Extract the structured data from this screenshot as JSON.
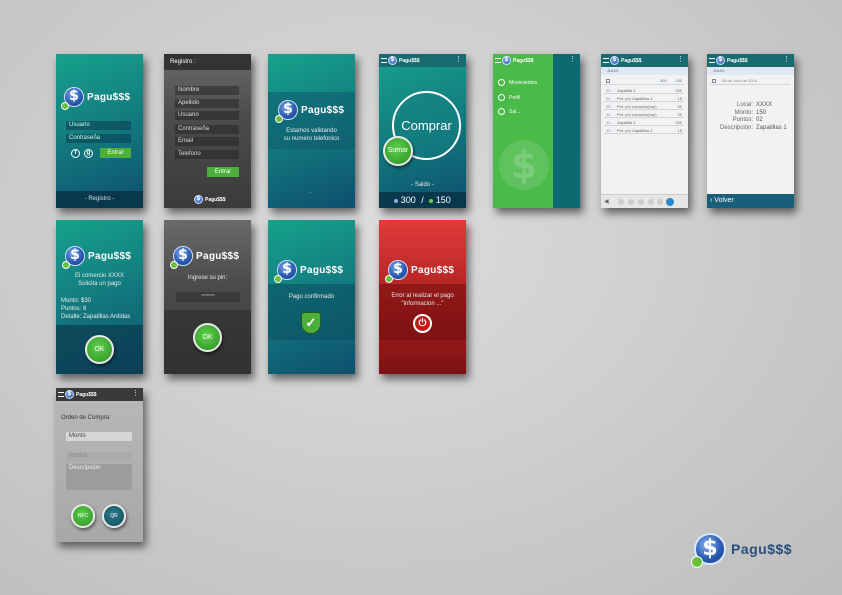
{
  "brand": {
    "name": "Pagu$$$",
    "coin_symbol": "$"
  },
  "s1": {
    "user_placeholder": "Usuario",
    "pass_placeholder": "Contraseña",
    "login_button": "Entrar",
    "register_link": "- Registro -",
    "social_fb": "f",
    "social_g": "g"
  },
  "s2": {
    "header": "Registro :",
    "fields": [
      "Nombre",
      "Apellido",
      "Usuario",
      "Contraseña",
      "Email",
      "Telefono"
    ],
    "button": "Entrar",
    "footer_logo": "Pagu$$$"
  },
  "s3": {
    "message_line1": "Estamos validando",
    "message_line2": "su numero telefonico",
    "spinner": "..."
  },
  "s4": {
    "buy": "Comprar",
    "add": "Sumar",
    "balance_label": "- Saldo -",
    "balance_left": "300",
    "slash": "/",
    "balance_right": "150"
  },
  "s5": {
    "menu": [
      "Movimientos",
      "Perfil",
      "Sal..."
    ]
  },
  "s6": {
    "month": "JULIO",
    "col_total": "300",
    "col_pts": "150",
    "rows": [
      {
        "n": "03",
        "l": "Zapatilla 1",
        "v": "150"
      },
      {
        "n": "04",
        "l": "Pnt. por Zapatillas 1",
        "v": "15"
      },
      {
        "n": "05",
        "l": "Pnt. por compras(sup)",
        "v": "30"
      },
      {
        "n": "11",
        "l": "Pnt. por compras(sup)",
        "v": "20"
      },
      {
        "n": "12",
        "l": "Zapatilla 2",
        "v": "150"
      },
      {
        "n": "13",
        "l": "Pnt. por Zapatillas 2",
        "v": "15"
      }
    ]
  },
  "s7": {
    "month": "JULIO",
    "date": "08 de Julio de 2016",
    "local_label": "Local:",
    "local_value": "XXXX",
    "monto_label": "Monto:",
    "monto_value": "150",
    "puntos_label": "Puntos:",
    "puntos_value": "02",
    "desc_label": "Descripción:",
    "desc_value": "Zapatillas 1",
    "back": "Volver"
  },
  "s8": {
    "line1": "El comercio XXXX",
    "line2": "Solicita un pago",
    "monto": "Monto: $30",
    "puntos": "Puntos: 6",
    "detalle": "Detalle: Zapatillas Ardidas",
    "ok": "OK"
  },
  "s9": {
    "label": "Ingrese su pin:",
    "pin": "*******",
    "ok": "OK"
  },
  "s10": {
    "message": "Pago confirmado"
  },
  "s11": {
    "line1": "Error al realizar el pago",
    "line2": "\"informacion ...\""
  },
  "s12": {
    "title": "Orden de Compra:",
    "monto": "Monto",
    "puntos": "Puntos",
    "descripcion": "Descripcion",
    "nfc": "NFC",
    "qr": "QR"
  },
  "colors": {
    "teal": "#137e80",
    "green": "#4aba48",
    "red": "#c62828",
    "dark": "#4c4c4c"
  }
}
